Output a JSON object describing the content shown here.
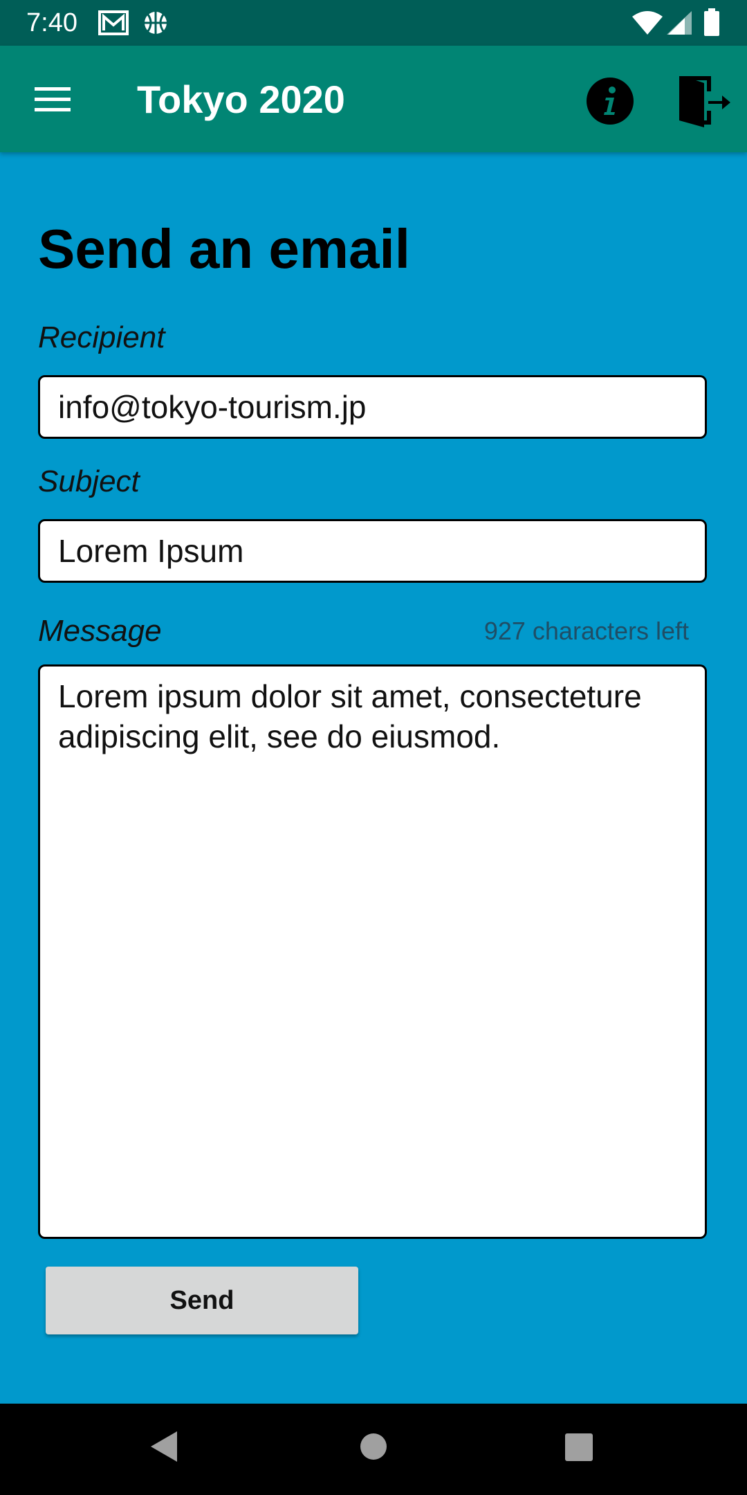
{
  "status_bar": {
    "time": "7:40",
    "icons_left": [
      "gmail-icon",
      "basketball-icon"
    ],
    "icons_right": [
      "wifi-icon",
      "cell-signal-icon",
      "battery-icon"
    ]
  },
  "app_bar": {
    "title": "Tokyo 2020",
    "background_color": "#018574",
    "icons": [
      "menu-icon",
      "info-icon",
      "logout-icon"
    ]
  },
  "form": {
    "heading": "Send an email",
    "recipient": {
      "label": "Recipient",
      "value": "info@tokyo-tourism.jp"
    },
    "subject": {
      "label": "Subject",
      "value": "Lorem Ipsum"
    },
    "message": {
      "label": "Message",
      "counter": "927 characters left",
      "value": "Lorem ipsum dolor sit amet, consecteture adipiscing elit, see do eiusmod."
    },
    "send_label": "Send"
  },
  "colors": {
    "page_background": "#0199CC",
    "status_bar": "#005E57",
    "button": "#D6D7D7"
  },
  "nav_bar": {
    "icons": [
      "back-icon",
      "home-icon",
      "recents-icon"
    ]
  }
}
